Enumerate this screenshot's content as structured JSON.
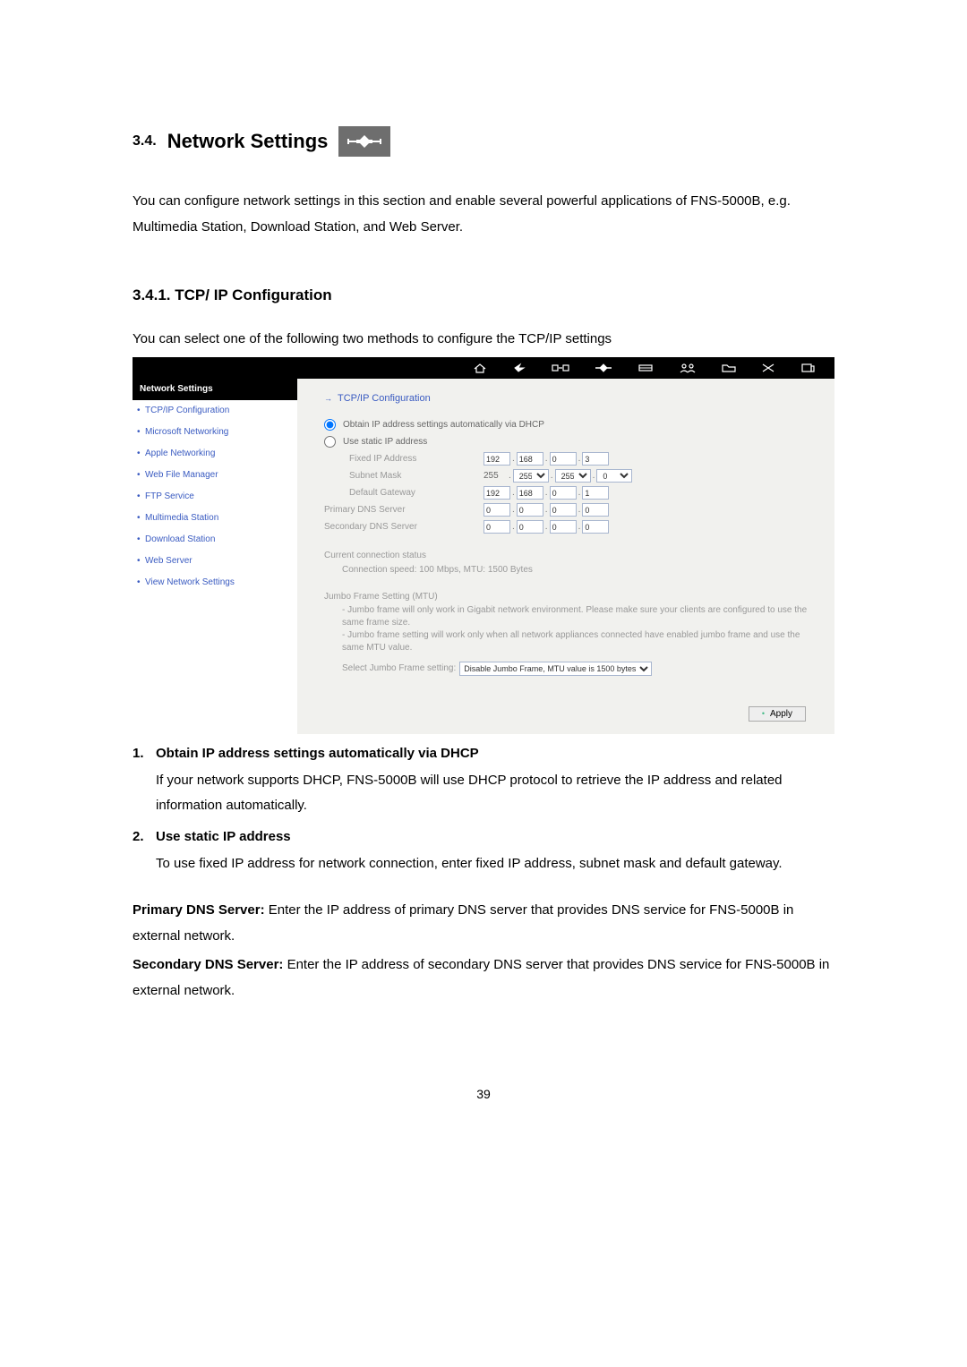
{
  "heading": {
    "num": "3.4.",
    "title": "Network Settings"
  },
  "intro": "You can configure network settings in this section and enable several powerful applications of FNS-5000B, e.g. Multimedia Station, Download Station, and Web Server.",
  "sub": {
    "num_title": "3.4.1.  TCP/ IP Configuration",
    "intro": "You can select one of the following two methods to configure the TCP/IP settings"
  },
  "panel": {
    "sidebar_header": "Network Settings",
    "sidebar_items": [
      "TCP/IP Configuration",
      "Microsoft Networking",
      "Apple Networking",
      "Web File Manager",
      "FTP Service",
      "Multimedia Station",
      "Download Station",
      "Web Server",
      "View Network Settings"
    ],
    "pane_title": "TCP/IP Configuration",
    "radio1": "Obtain IP address settings automatically via DHCP",
    "radio2": "Use static IP address",
    "fields": {
      "fixed_ip": {
        "label": "Fixed IP Address",
        "v": [
          "192",
          "168",
          "0",
          "3"
        ]
      },
      "subnet": {
        "label": "Subnet Mask",
        "sel1": "255",
        "sel2": "255",
        "sel3": "255",
        "sel4": "0"
      },
      "gateway": {
        "label": "Default Gateway",
        "v": [
          "192",
          "168",
          "0",
          "1"
        ]
      },
      "pdns": {
        "label": "Primary DNS Server",
        "v": [
          "0",
          "0",
          "0",
          "0"
        ]
      },
      "sdns": {
        "label": "Secondary DNS Server",
        "v": [
          "0",
          "0",
          "0",
          "0"
        ]
      }
    },
    "conn": {
      "l1": "Current connection status",
      "l2": "Connection speed: 100 Mbps, MTU: 1500 Bytes"
    },
    "jumbo": {
      "title": "Jumbo Frame Setting (MTU)",
      "l1": "- Jumbo frame will only work in Gigabit network environment. Please make sure your clients are configured to use the same frame size.",
      "l2": "- Jumbo frame setting will work only when all network appliances connected have enabled jumbo frame and use the same MTU value.",
      "select_label": "Select Jumbo Frame setting:",
      "select_value": "Disable Jumbo Frame, MTU value is 1500 bytes"
    },
    "apply": "Apply"
  },
  "list": {
    "i1_head": "Obtain IP address settings automatically via DHCP",
    "i1_body": "If your network supports DHCP, FNS-5000B will use DHCP protocol to retrieve the IP address and related information automatically.",
    "i2_head": "Use static IP address",
    "i2_body": "To use fixed IP address for network connection, enter fixed IP address, subnet mask and default gateway."
  },
  "para1_label": "Primary DNS Server:",
  "para1_text": " Enter the IP address of primary DNS server that provides DNS service for FNS-5000B in external network.",
  "para2_label": "Secondary DNS Server:",
  "para2_text": " Enter the IP address of secondary DNS server that provides DNS service for FNS-5000B in external network.",
  "page_num": "39"
}
